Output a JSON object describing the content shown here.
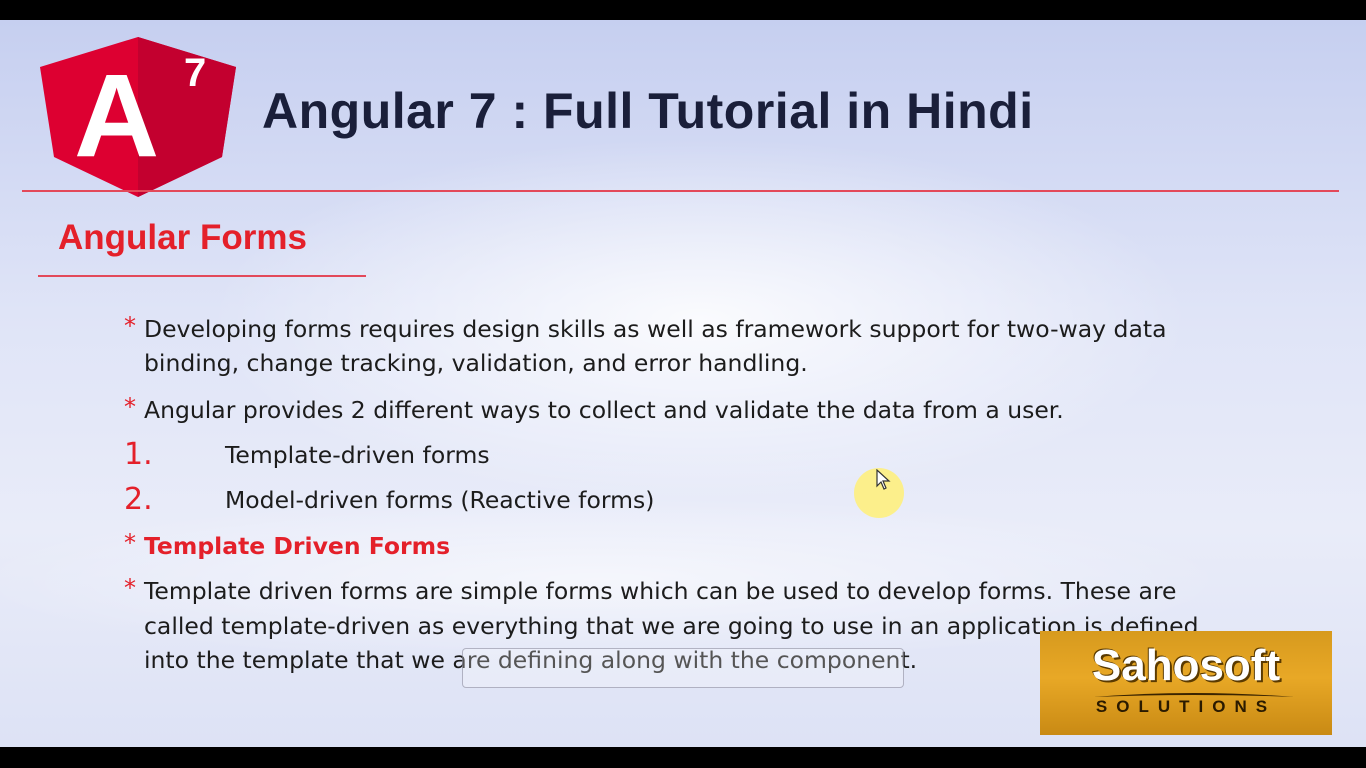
{
  "header": {
    "logo_letter": "A",
    "logo_version": "7",
    "title": "Angular 7 : Full Tutorial in Hindi"
  },
  "section": {
    "title": "Angular Forms"
  },
  "bullets": [
    {
      "marker": "*",
      "lines": [
        "Developing forms requires design skills as well as framework support for two-way data",
        "binding, change tracking, validation, and error handling."
      ]
    },
    {
      "marker": "*",
      "lines": [
        "Angular provides 2 different ways to collect and validate the data from a user."
      ]
    }
  ],
  "numbered": [
    {
      "num": "1.",
      "text": "Template-driven forms"
    },
    {
      "num": "2.",
      "text": "Model-driven forms (Reactive forms)"
    }
  ],
  "subheading": {
    "marker": "*",
    "text": "Template Driven Forms"
  },
  "paragraph": {
    "marker": "*",
    "lines": [
      "Template driven forms are simple forms which can be used to develop forms. These are",
      "called template-driven as everything that we are going to use in an application is defined",
      "into the template that we are defining along with the component."
    ]
  },
  "brand": {
    "name": "Sahosoft",
    "tagline": "SOLUTIONS"
  },
  "colors": {
    "accent_red": "#e4202a",
    "logo_red": "#dd0031",
    "title_navy": "#1a1f3a",
    "brand_gold": "#e8a826"
  },
  "icons": [
    "angular-logo-icon",
    "cursor-arrow-icon"
  ]
}
